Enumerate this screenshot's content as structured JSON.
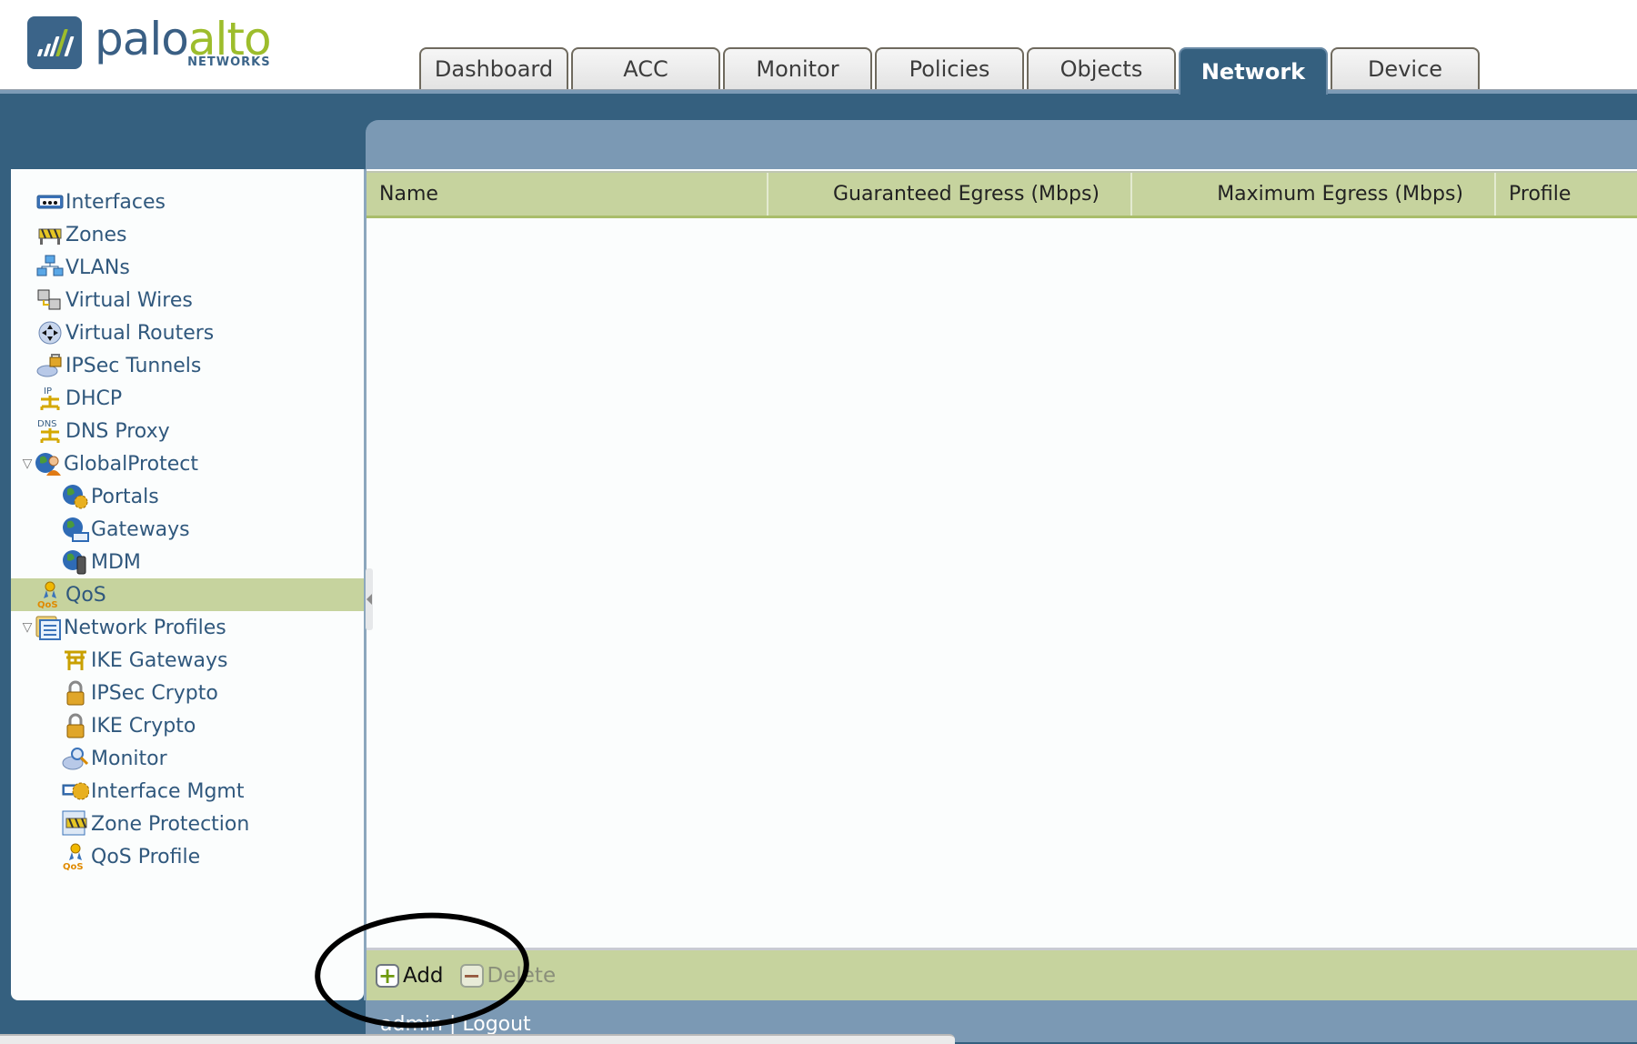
{
  "brand": {
    "word_part1": "palo",
    "word_part2": "alto",
    "sub": "NETWORKS",
    "primary_color": "#3a5f84",
    "accent_color": "#9dbd2c"
  },
  "tabs": [
    {
      "label": "Dashboard",
      "active": false
    },
    {
      "label": "ACC",
      "active": false
    },
    {
      "label": "Monitor",
      "active": false
    },
    {
      "label": "Policies",
      "active": false
    },
    {
      "label": "Objects",
      "active": false
    },
    {
      "label": "Network",
      "active": true
    },
    {
      "label": "Device",
      "active": false
    }
  ],
  "sidebar": {
    "items": [
      {
        "label": "Interfaces",
        "icon": "ethernet-port-icon",
        "level": 0
      },
      {
        "label": "Zones",
        "icon": "barrier-icon",
        "level": 0
      },
      {
        "label": "VLANs",
        "icon": "network-computers-icon",
        "level": 0
      },
      {
        "label": "Virtual Wires",
        "icon": "virtual-wire-icon",
        "level": 0
      },
      {
        "label": "Virtual Routers",
        "icon": "router-icon",
        "level": 0
      },
      {
        "label": "IPSec Tunnels",
        "icon": "tunnel-lock-icon",
        "level": 0
      },
      {
        "label": "DHCP",
        "icon": "dhcp-ip-icon",
        "level": 0
      },
      {
        "label": "DNS Proxy",
        "icon": "dns-icon",
        "level": 0
      },
      {
        "label": "GlobalProtect",
        "icon": "globe-user-icon",
        "level": 0,
        "expanded": true
      },
      {
        "label": "Portals",
        "icon": "globe-gear-icon",
        "level": 1
      },
      {
        "label": "Gateways",
        "icon": "globe-gateway-icon",
        "level": 1
      },
      {
        "label": "MDM",
        "icon": "globe-device-icon",
        "level": 1
      },
      {
        "label": "QoS",
        "icon": "qos-ribbon-icon",
        "level": 0,
        "selected": true
      },
      {
        "label": "Network Profiles",
        "icon": "profile-folder-icon",
        "level": 0,
        "expanded": true
      },
      {
        "label": "IKE Gateways",
        "icon": "gate-icon",
        "level": 1
      },
      {
        "label": "IPSec Crypto",
        "icon": "lock-icon",
        "level": 1
      },
      {
        "label": "IKE Crypto",
        "icon": "lock-icon",
        "level": 1
      },
      {
        "label": "Monitor",
        "icon": "magnifier-icon",
        "level": 1
      },
      {
        "label": "Interface Mgmt",
        "icon": "interface-gear-icon",
        "level": 1
      },
      {
        "label": "Zone Protection",
        "icon": "zone-shield-icon",
        "level": 1
      },
      {
        "label": "QoS Profile",
        "icon": "qos-ribbon-icon",
        "level": 1
      }
    ]
  },
  "table": {
    "columns": [
      "Name",
      "Guaranteed Egress (Mbps)",
      "Maximum Egress (Mbps)",
      "Profile"
    ],
    "rows": []
  },
  "toolbar": {
    "add_label": "Add",
    "delete_label": "Delete",
    "add_symbol": "+",
    "delete_symbol": "−"
  },
  "footer": {
    "user": "admin",
    "separator": "|",
    "logout": "Logout"
  },
  "colors": {
    "header_band": "#35607f",
    "panel": "#7b99b4",
    "table_header": "#c6d39e",
    "link_text": "#30587d"
  }
}
